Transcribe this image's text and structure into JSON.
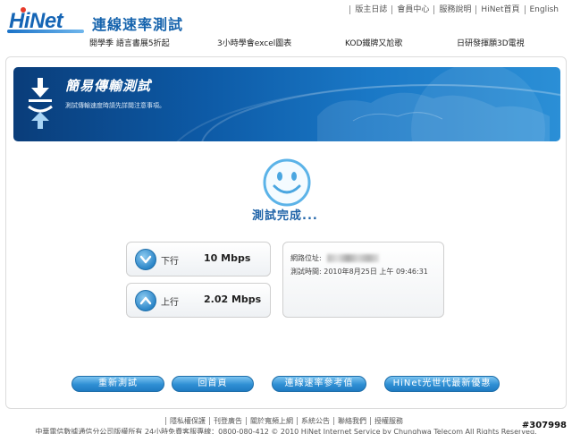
{
  "header": {
    "logo_text": "HiNet",
    "site_title": "連線速率測試",
    "top_links": [
      "版主日誌",
      "會員中心",
      "服務說明",
      "HiNet首頁",
      "English"
    ],
    "promo_links": [
      "開學季 語言書展5折起",
      "3小時學會excel圖表",
      "KOD鐵牌又尬歌",
      "日研發揮願3D電視"
    ]
  },
  "banner": {
    "title": "簡易傳輸測試",
    "subtitle": "測試傳輸速度時請先詳閱注意事項。"
  },
  "status": {
    "text": "測試完成..."
  },
  "results": {
    "download": {
      "label": "下行",
      "value": "10 Mbps"
    },
    "upload": {
      "label": "上行",
      "value": "2.02 Mbps"
    }
  },
  "info": {
    "ip_label": "網路位址:",
    "time_label": "測試時間:",
    "time_value": "2010年8月25日 上午 09:46:31"
  },
  "buttons": {
    "retest": "重新測試",
    "home": "回首頁",
    "reference": "連線速率參考值",
    "promo": "HiNet光世代最新優惠"
  },
  "footer": {
    "links": [
      "隱私權保護",
      "刊登廣告",
      "關於寬頻上網",
      "系統公告",
      "聯絡我們",
      "授權服務"
    ],
    "copyright": "中華電信數據通信分公司版權所有 24小時免費客服專線：0800-080-412 © 2010 HiNet Internet Service by Chunghwa Telecom All Rights Reserved.",
    "watermark": "#307998"
  },
  "colors": {
    "brand_blue": "#1563ad",
    "button_blue": "#2f8fd4",
    "banner_dark": "#0a3d7a"
  }
}
